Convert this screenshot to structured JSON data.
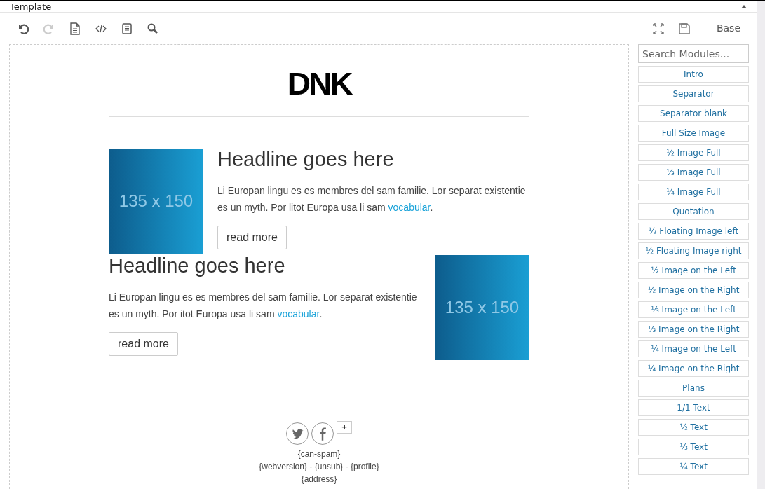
{
  "window": {
    "title": "Template"
  },
  "toolbar": {
    "left": [
      {
        "disabled": false
      },
      {
        "disabled": true
      },
      {
        "disabled": false
      },
      {
        "disabled": false
      },
      {
        "disabled": false
      },
      {
        "disabled": false
      }
    ],
    "theme_label": "Base"
  },
  "email": {
    "logo": "DNK",
    "articles": [
      {
        "image_text": "135 x 150",
        "headline": "Headline goes here",
        "body": "Li Europan lingu es es membres del sam familie. Lor separat existentie es un myth. Por litot Europa usa li sam ",
        "link": "vocabular",
        "after_link": ".",
        "button": "read more"
      },
      {
        "image_text": "135 x 150",
        "headline": "Headline goes here",
        "body": "Li Europan lingu es es membres del sam familie. Lor separat existentie es un myth. Por itot Europa usa li sam ",
        "link": "vocabular",
        "after_link": ".",
        "button": "read more"
      }
    ],
    "add_button": "+",
    "footer": [
      "{can-spam}",
      "{webversion} - {unsub} - {profile}",
      "{address}"
    ]
  },
  "modules": {
    "search_placeholder": "Search Modules...",
    "items": [
      "Intro",
      "Separator",
      "Separator blank",
      "Full Size Image",
      "½ Image Full",
      "⅓ Image Full",
      "¼ Image Full",
      "Quotation",
      "½ Floating Image left",
      "½ Floating Image right",
      "½ Image on the Left",
      "½ Image on the Right",
      "⅓ Image on the Left",
      "⅓ Image on the Right",
      "¼ Image on the Left",
      "¼ Image on the Right",
      "Plans",
      "1/1 Text",
      "½ Text",
      "⅓ Text",
      "¼ Text"
    ]
  }
}
